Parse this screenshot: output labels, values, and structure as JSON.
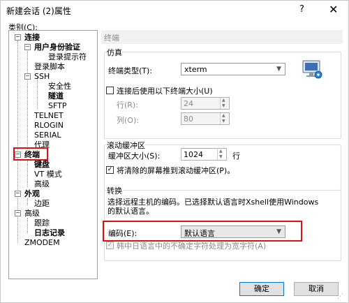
{
  "window": {
    "title": "新建会话 (2)属性",
    "help": "?",
    "close": "✕"
  },
  "category_label": "类别(C):",
  "tree": {
    "connection": "连接",
    "auth": "用户身份验证",
    "login_prompt": "登录提示符",
    "login_script": "登录脚本",
    "ssh": "SSH",
    "security": "安全性",
    "tunnel": "隧道",
    "sftp": "SFTP",
    "telnet": "TELNET",
    "rlogin": "RLOGIN",
    "serial": "SERIAL",
    "proxy": "代理",
    "terminal": "终端",
    "keyboard": "键盘",
    "vt_mode": "VT 模式",
    "advanced_t": "高级",
    "appearance": "外观",
    "margin": "边距",
    "advanced": "高级",
    "trace": "跟踪",
    "logging": "日志记录",
    "zmodem": "ZMODEM"
  },
  "panel": {
    "header": "终端",
    "emulation": {
      "title": "仿真",
      "terminal_type_label": "终端类型(T):",
      "terminal_type_value": "xterm",
      "resize_label": "连接后使用以下终端大小(U)",
      "rows_label": "行(R):",
      "rows_value": "24",
      "cols_label": "列(O):",
      "cols_value": "80"
    },
    "scrollback": {
      "title": "滚动缓冲区",
      "size_label": "缓冲区大小(S):",
      "size_value": "1024",
      "unit": "行",
      "push_label": "将清除的屏幕推到滚动缓冲区(P)。"
    },
    "translation": {
      "title": "转换",
      "desc": "选择远程主机的编码。已选择默认语言时Xshell使用Windows的默认语言。",
      "encoding_label": "编码(E):",
      "encoding_value": "默认语言",
      "cjk_label": "韩中日语言中的不确定字符处理为宽字符(A)"
    }
  },
  "buttons": {
    "ok": "确定",
    "cancel": "取消"
  },
  "colors": {
    "highlight": "#e01010",
    "accent": "#0078d7"
  },
  "icons": {
    "terminal_monitor": "monitor-gear-icon"
  }
}
